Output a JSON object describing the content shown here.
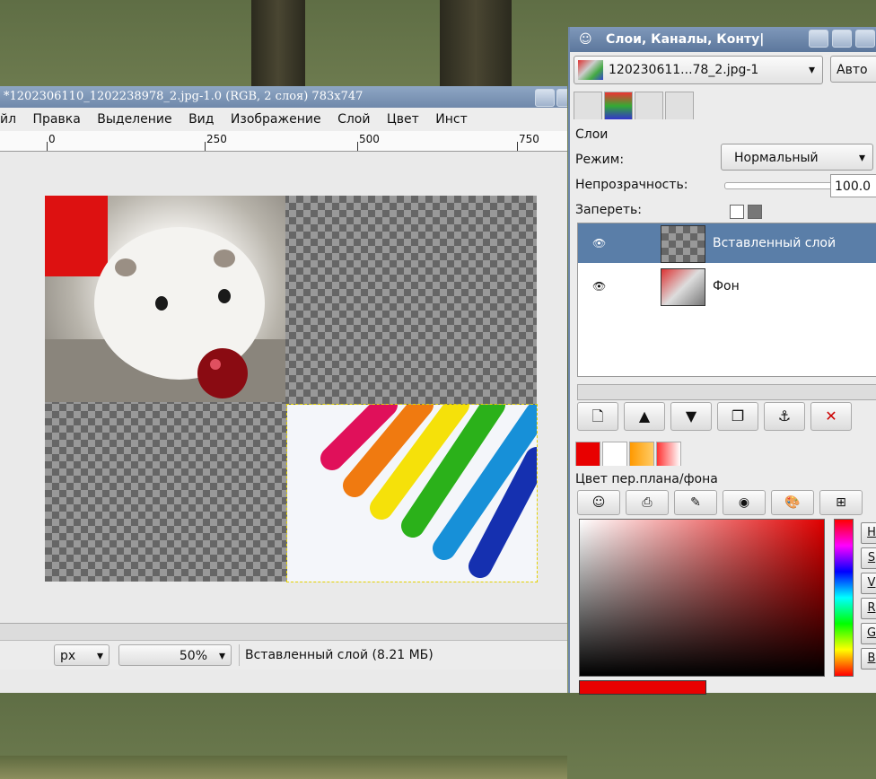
{
  "image_window": {
    "title": "*1202306110_1202238978_2.jpg-1.0 (RGB, 2 слоя) 783x747",
    "menu": [
      "йл",
      "Правка",
      "Выделение",
      "Вид",
      "Изображение",
      "Слой",
      "Цвет",
      "Инст"
    ],
    "ruler_labels": [
      "0",
      "250",
      "500",
      "750"
    ],
    "unit": "px",
    "zoom": "50%",
    "status": "Вставленный слой (8.21 МБ)"
  },
  "dock": {
    "title": "Слои, Каналы, Конту|",
    "image_select": "120230611...78_2.jpg-1",
    "auto_button": "Авто",
    "layers_label": "Слои",
    "mode_label": "Режим:",
    "mode_value": "Нормальный",
    "opacity_label": "Непрозрачность:",
    "opacity_value": "100.0",
    "lock_label": "Запереть:",
    "layers": [
      {
        "name": "Вставленный слой",
        "selected": true
      },
      {
        "name": "Фон",
        "selected": false
      }
    ],
    "color_title": "Цвет пер.плана/фона",
    "channels": [
      "H",
      "S",
      "V",
      "R",
      "G",
      "B"
    ],
    "colors": {
      "foreground": "#e80000",
      "selection": "#5a7ea8"
    }
  }
}
